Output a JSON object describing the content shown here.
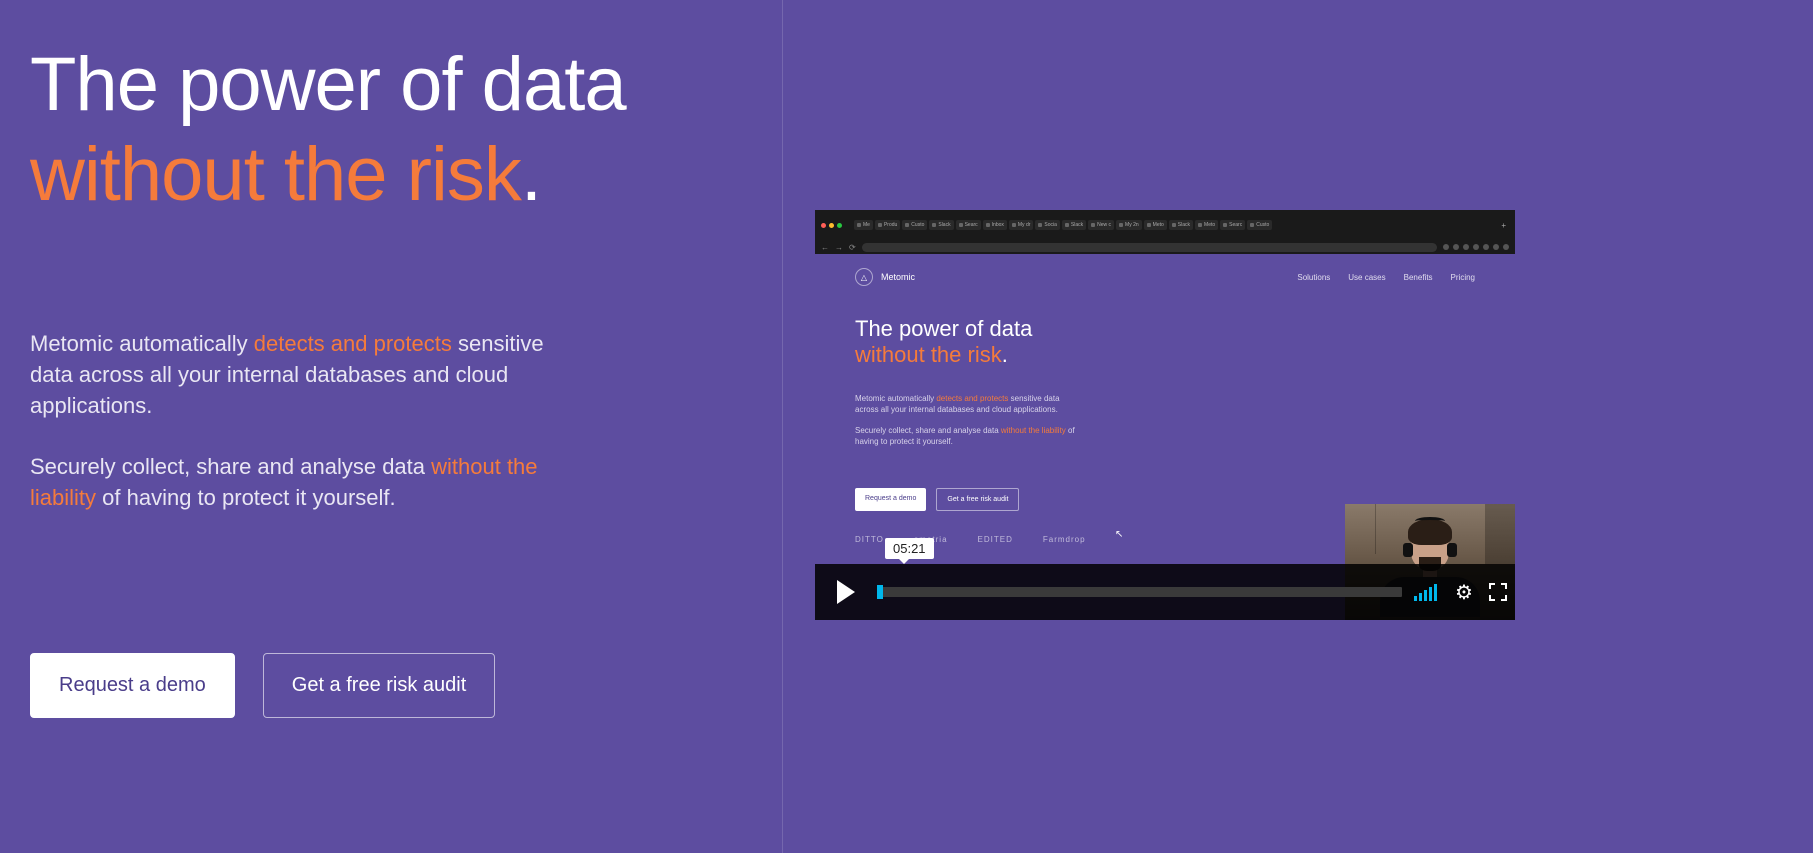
{
  "hero": {
    "headline_line1": "The power of data",
    "headline_line2": "without the risk",
    "headline_dot": ".",
    "sub1_a": "Metomic automatically ",
    "sub1_orange": "detects and protects",
    "sub1_b": " sensitive data across all your internal databases and cloud applications.",
    "sub2_a": "Securely collect, share and analyse data ",
    "sub2_orange": "without the liability",
    "sub2_b": " of having to protect it yourself.",
    "cta_primary": "Request a demo",
    "cta_secondary": "Get a free risk audit"
  },
  "video": {
    "timestamp": "05:21",
    "browser_tabs": [
      "Me",
      "Produ",
      "Custo",
      "Slack",
      "Searc",
      "Inbox",
      "My dr",
      "Socia",
      "Slack",
      "New c",
      "My 2n",
      "Meto",
      "Slack",
      "Meto",
      "Searc",
      "Custo"
    ],
    "inner": {
      "brand": "Metomic",
      "nav": [
        "Solutions",
        "Use cases",
        "Benefits",
        "Pricing"
      ],
      "headline_line1": "The power of data",
      "headline_line2": "without the risk",
      "headline_dot": ".",
      "sub1_a": "Metomic automatically ",
      "sub1_orange": "detects and protects",
      "sub1_b": " sensitive data across all your internal databases and cloud applications.",
      "sub2_a": "Securely collect, share and analyse data ",
      "sub2_orange": "without the liability",
      "sub2_b": " of having to protect it yourself.",
      "btn_p": "Request a demo",
      "btn_s": "Get a free risk audit",
      "logos": [
        "DITTO",
        "ometria",
        "EDITED",
        "Farmdrop"
      ]
    }
  }
}
